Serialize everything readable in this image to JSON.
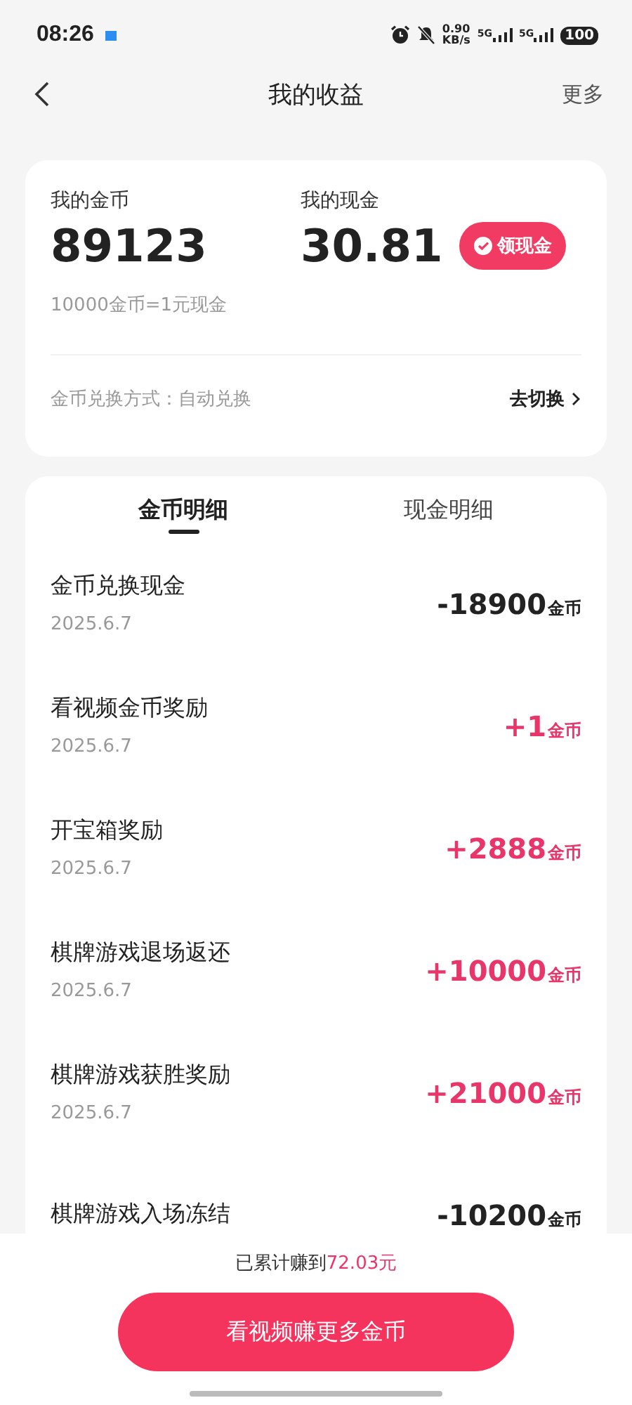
{
  "status_bar": {
    "time": "08:26",
    "net_speed": "0.90",
    "net_unit": "KB/s",
    "sim1": "5G",
    "sim2": "5G",
    "battery": "100"
  },
  "nav": {
    "title": "我的收益",
    "more": "更多"
  },
  "summary": {
    "coins_label": "我的金币",
    "coins": "89123",
    "cash_label": "我的现金",
    "cash": "30.81",
    "withdraw": "领现金",
    "rate": "10000金币=1元现金",
    "mode": "金币兑换方式：自动兑换",
    "switch": "去切换"
  },
  "tabs": [
    {
      "label": "金币明细",
      "selected": true
    },
    {
      "label": "现金明细",
      "selected": false
    }
  ],
  "records": [
    {
      "title": "金币兑换现金",
      "date": "2025.6.7",
      "amount": "-18900",
      "unit": "金币",
      "kind": "expense"
    },
    {
      "title": "看视频金币奖励",
      "date": "2025.6.7",
      "amount": "+1",
      "unit": "金币",
      "kind": "income"
    },
    {
      "title": "开宝箱奖励",
      "date": "2025.6.7",
      "amount": "+2888",
      "unit": "金币",
      "kind": "income"
    },
    {
      "title": "棋牌游戏退场返还",
      "date": "2025.6.7",
      "amount": "+10000",
      "unit": "金币",
      "kind": "income"
    },
    {
      "title": "棋牌游戏获胜奖励",
      "date": "2025.6.7",
      "amount": "+21000",
      "unit": "金币",
      "kind": "income"
    },
    {
      "title": "棋牌游戏入场冻结",
      "amount": "-10200",
      "unit": "金币",
      "kind": "expense"
    }
  ],
  "footer": {
    "earned": "已累计赚到**72.03元**",
    "button": "看视频赚更多金币"
  }
}
